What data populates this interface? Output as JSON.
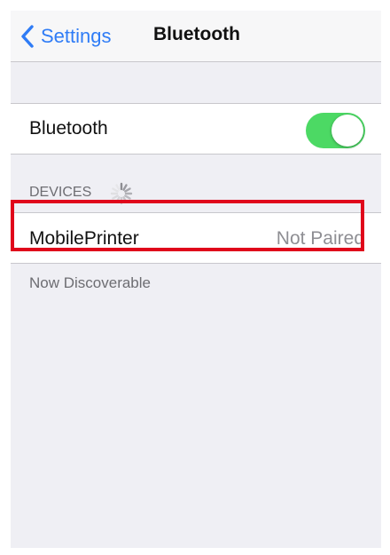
{
  "navbar": {
    "back_label": "Settings",
    "title": "Bluetooth",
    "back_icon": "chevron-left-icon"
  },
  "bluetooth_toggle": {
    "label": "Bluetooth",
    "on": true
  },
  "devices_section": {
    "header": "DEVICES",
    "loading_icon": "spinner-icon"
  },
  "devices": [
    {
      "name": "MobilePrinter",
      "status": "Not Paired"
    }
  ],
  "footer_note": "Now Discoverable",
  "colors": {
    "accent": "#2f7cf6",
    "switch_on": "#4cd964",
    "highlight": "#e0061b",
    "background": "#efeff4"
  }
}
